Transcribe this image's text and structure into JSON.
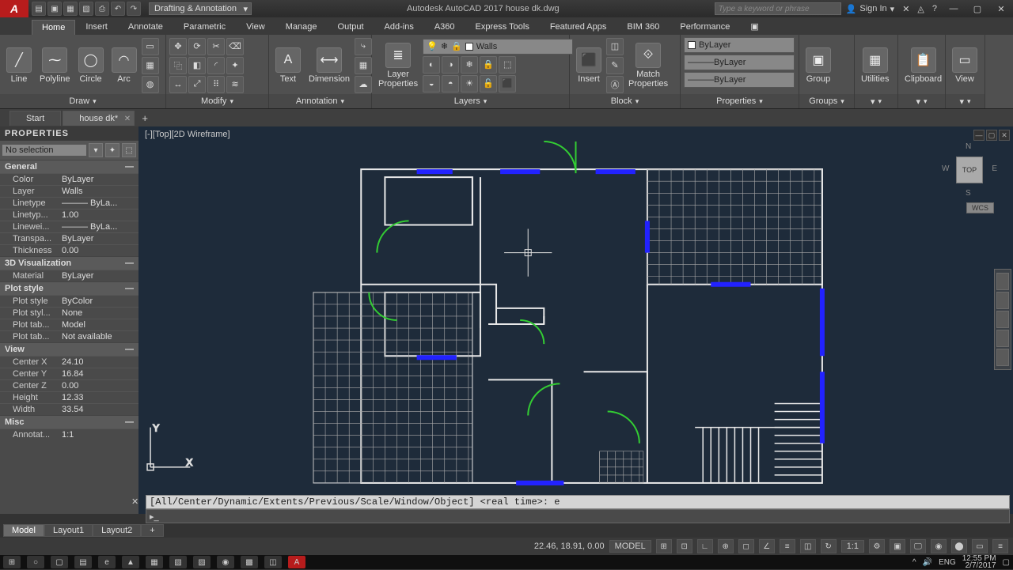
{
  "app": {
    "logo": "A",
    "title": "Autodesk AutoCAD 2017   house dk.dwg",
    "workspace": "Drafting & Annotation",
    "search_ph": "Type a keyword or phrase",
    "signin": "Sign In"
  },
  "menu": {
    "tabs": [
      "Home",
      "Insert",
      "Annotate",
      "Parametric",
      "View",
      "Manage",
      "Output",
      "Add-ins",
      "A360",
      "Express Tools",
      "Featured Apps",
      "BIM 360",
      "Performance"
    ],
    "active": 0
  },
  "ribbon": {
    "draw": {
      "title": "Draw",
      "items": [
        "Line",
        "Polyline",
        "Circle",
        "Arc"
      ]
    },
    "modify": {
      "title": "Modify"
    },
    "annotation": {
      "title": "Annotation",
      "text": "Text",
      "dim": "Dimension"
    },
    "layers": {
      "title": "Layers",
      "lp": "Layer\nProperties",
      "current": "Walls"
    },
    "block": {
      "title": "Block",
      "insert": "Insert",
      "match": "Match\nProperties"
    },
    "properties": {
      "title": "Properties",
      "color": "ByLayer",
      "lw": "ByLayer",
      "lt": "ByLayer"
    },
    "groups": {
      "title": "Groups",
      "group": "Group"
    },
    "utilities": {
      "title": "Utilities"
    },
    "clipboard": {
      "title": "Clipboard"
    },
    "view": {
      "title": "View"
    }
  },
  "file_tabs": {
    "items": [
      "Start",
      "house dk*"
    ],
    "active": 1
  },
  "viewport": {
    "label": "[-][Top][2D Wireframe]",
    "cube": "TOP",
    "wcs": "WCS"
  },
  "properties": {
    "title": "PROPERTIES",
    "selection": "No selection",
    "cats": {
      "General": [
        {
          "k": "Color",
          "v": "ByLayer"
        },
        {
          "k": "Layer",
          "v": "Walls"
        },
        {
          "k": "Linetype",
          "v": "——— ByLa..."
        },
        {
          "k": "Linetyp...",
          "v": "1.00"
        },
        {
          "k": "Linewei...",
          "v": "——— ByLa..."
        },
        {
          "k": "Transpa...",
          "v": "ByLayer"
        },
        {
          "k": "Thickness",
          "v": "0.00"
        }
      ],
      "3D Visualization": [
        {
          "k": "Material",
          "v": "ByLayer"
        }
      ],
      "Plot style": [
        {
          "k": "Plot style",
          "v": "ByColor"
        },
        {
          "k": "Plot styl...",
          "v": "None"
        },
        {
          "k": "Plot tab...",
          "v": "Model"
        },
        {
          "k": "Plot tab...",
          "v": "Not available"
        }
      ],
      "View": [
        {
          "k": "Center X",
          "v": "24.10"
        },
        {
          "k": "Center Y",
          "v": "16.84"
        },
        {
          "k": "Center Z",
          "v": "0.00"
        },
        {
          "k": "Height",
          "v": "12.33"
        },
        {
          "k": "Width",
          "v": "33.54"
        }
      ],
      "Misc": [
        {
          "k": "Annotat...",
          "v": "1:1"
        }
      ]
    }
  },
  "cmd": {
    "hist": "[All/Center/Dynamic/Extents/Previous/Scale/Window/Object] <real time>: e"
  },
  "layout_tabs": {
    "items": [
      "Model",
      "Layout1",
      "Layout2"
    ],
    "active": 0
  },
  "status": {
    "coords": "22.46, 18.91, 0.00",
    "space": "MODEL",
    "scale": "1:1"
  },
  "taskbar": {
    "lang": "ENG",
    "time": "12:55 PM",
    "date": "2/7/2017"
  }
}
